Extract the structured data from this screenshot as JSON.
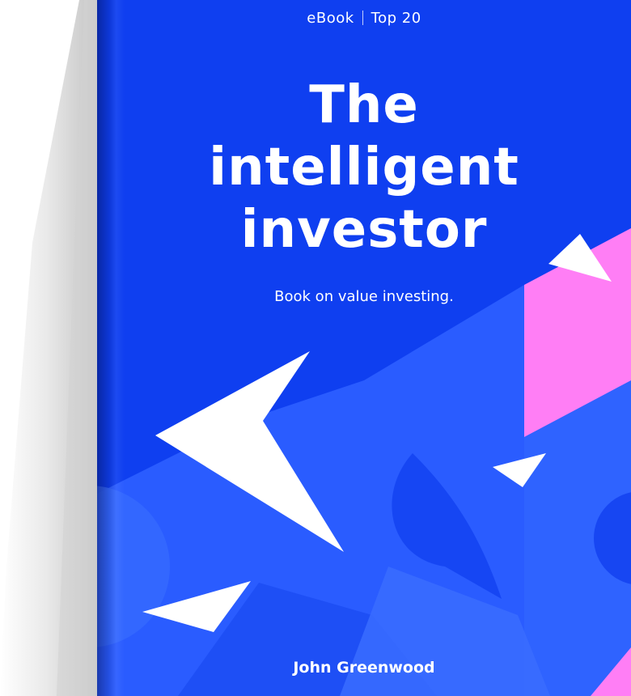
{
  "cover": {
    "format": "eBook",
    "ranking": "Top 20",
    "title_lines": [
      "The",
      "intelligent",
      "investor"
    ],
    "subtitle": "Book on value investing.",
    "author": "John Greenwood"
  },
  "colors": {
    "cover_blue": "#0f3ff0",
    "shape_blue": "#2f63ff",
    "accent_pink": "#ff7ef5",
    "text": "#ffffff"
  }
}
